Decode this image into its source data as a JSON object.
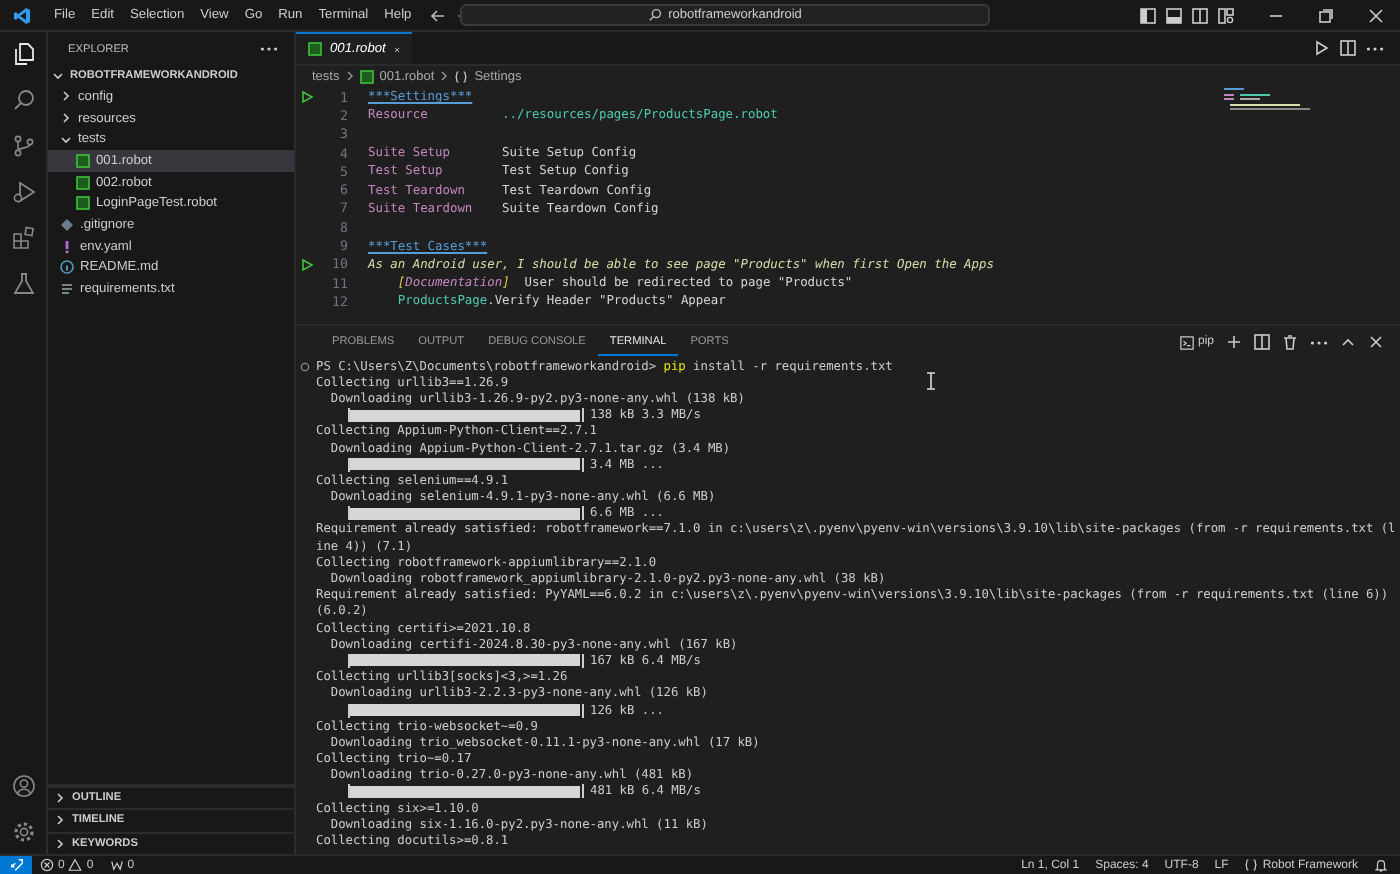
{
  "title_bar": {
    "menu": [
      "File",
      "Edit",
      "Selection",
      "View",
      "Go",
      "Run",
      "Terminal",
      "Help"
    ],
    "search": {
      "value": "robotframeworkandroid"
    }
  },
  "sidebar": {
    "title": "EXPLORER",
    "root": {
      "name": "ROBOTFRAMEWORKANDROID",
      "expanded": true,
      "children": [
        {
          "name": "config",
          "kind": "folder",
          "expanded": false,
          "selected": false
        },
        {
          "name": "resources",
          "kind": "folder",
          "expanded": false,
          "selected": false
        },
        {
          "name": "tests",
          "kind": "folder",
          "expanded": true,
          "selected": false,
          "children": [
            {
              "name": "001.robot",
              "kind": "robot",
              "selected": true
            },
            {
              "name": "002.robot",
              "kind": "robot",
              "selected": false
            },
            {
              "name": "LoginPageTest.robot",
              "kind": "robot",
              "selected": false
            }
          ]
        },
        {
          "name": ".gitignore",
          "kind": "gitignore",
          "selected": false
        },
        {
          "name": "env.yaml",
          "kind": "yaml",
          "selected": false
        },
        {
          "name": "README.md",
          "kind": "markdown",
          "selected": false
        },
        {
          "name": "requirements.txt",
          "kind": "text",
          "selected": false
        }
      ]
    },
    "sections": [
      {
        "label": "OUTLINE",
        "expanded": false
      },
      {
        "label": "TIMELINE",
        "expanded": false
      },
      {
        "label": "KEYWORDS",
        "expanded": false
      }
    ]
  },
  "editor": {
    "tab": {
      "label": "001.robot"
    },
    "breadcrumb": [
      "tests",
      "001.robot",
      "Settings"
    ],
    "lines": [
      {
        "number": "1",
        "kind": "section",
        "run": true,
        "segments": [
          {
            "kind": "header",
            "text": "***Settings***"
          }
        ]
      },
      {
        "number": "2",
        "kind": "setting",
        "run": false,
        "segments": [
          {
            "kind": "setting",
            "text": "Resource"
          },
          {
            "kind": "path",
            "text": "../resources/pages/ProductsPage.robot"
          }
        ]
      },
      {
        "number": "3",
        "kind": "blank",
        "run": false
      },
      {
        "number": "4",
        "kind": "setting",
        "run": false,
        "segments": [
          {
            "kind": "setting",
            "text": "Suite Setup"
          },
          {
            "kind": "plain",
            "text": "Suite Setup Config"
          }
        ]
      },
      {
        "number": "5",
        "kind": "setting",
        "run": false,
        "segments": [
          {
            "kind": "setting",
            "text": "Test Setup"
          },
          {
            "kind": "plain",
            "text": "Test Setup Config"
          }
        ]
      },
      {
        "number": "6",
        "kind": "setting",
        "run": false,
        "segments": [
          {
            "kind": "setting",
            "text": "Test Teardown"
          },
          {
            "kind": "plain",
            "text": "Test Teardown Config"
          }
        ]
      },
      {
        "number": "7",
        "kind": "setting",
        "run": false,
        "segments": [
          {
            "kind": "setting",
            "text": "Suite Teardown"
          },
          {
            "kind": "plain",
            "text": "Suite Teardown Config"
          }
        ]
      },
      {
        "number": "8",
        "kind": "blank",
        "run": false
      },
      {
        "number": "9",
        "kind": "section",
        "run": false,
        "segments": [
          {
            "kind": "header",
            "text": "***Test Cases***"
          }
        ]
      },
      {
        "number": "10",
        "kind": "test",
        "run": true,
        "segments": [
          {
            "kind": "testname",
            "text": "As an Android user, I should be able to see page \"Products\" when first Open the Apps"
          }
        ]
      },
      {
        "number": "11",
        "kind": "step",
        "run": false,
        "segments": [
          {
            "kind": "bracket",
            "text": "["
          },
          {
            "kind": "doc",
            "text": "Documentation"
          },
          {
            "kind": "bracket",
            "text": "]"
          },
          {
            "kind": "plain",
            "text": "  User should be redirected to page \"Products\""
          }
        ]
      },
      {
        "number": "12",
        "kind": "step",
        "run": false,
        "segments": [
          {
            "kind": "library",
            "text": "ProductsPage"
          },
          {
            "kind": "plain",
            "text": ".Verify Header \"Products\" Appear"
          }
        ]
      }
    ]
  },
  "panel": {
    "tabs": [
      {
        "label": "PROBLEMS",
        "selected": false
      },
      {
        "label": "OUTPUT",
        "selected": false
      },
      {
        "label": "DEBUG CONSOLE",
        "selected": false
      },
      {
        "label": "TERMINAL",
        "selected": true
      },
      {
        "label": "PORTS",
        "selected": false
      }
    ],
    "terminal_name": "pip",
    "terminal": [
      {
        "kind": "command",
        "prompt": "PS C:\\Users\\Z\\Documents\\robotframeworkandroid> ",
        "command": "pip",
        "args": " install -r requirements.txt"
      },
      {
        "kind": "text",
        "text": "Collecting urllib3==1.26.9"
      },
      {
        "kind": "text",
        "text": "  Downloading urllib3-1.26.9-py2.py3-none-any.whl (138 kB)"
      },
      {
        "kind": "progress",
        "level": 1,
        "text": "138 kB 3.3 MB/s"
      },
      {
        "kind": "text",
        "text": "Collecting Appium-Python-Client==2.7.1"
      },
      {
        "kind": "text",
        "text": "  Downloading Appium-Python-Client-2.7.1.tar.gz (3.4 MB)"
      },
      {
        "kind": "progress",
        "level": 1,
        "text": "3.4 MB ..."
      },
      {
        "kind": "text",
        "text": "Collecting selenium==4.9.1"
      },
      {
        "kind": "text",
        "text": "  Downloading selenium-4.9.1-py3-none-any.whl (6.6 MB)"
      },
      {
        "kind": "progress",
        "level": 1,
        "text": "6.6 MB ..."
      },
      {
        "kind": "text",
        "text": "Requirement already satisfied: robotframework==7.1.0 in c:\\users\\z\\.pyenv\\pyenv-win\\versions\\3.9.10\\lib\\site-packages (from -r requirements.txt (l"
      },
      {
        "kind": "text",
        "text": "ine 4)) (7.1)"
      },
      {
        "kind": "text",
        "text": "Collecting robotframework-appiumlibrary==2.1.0"
      },
      {
        "kind": "text",
        "text": "  Downloading robotframework_appiumlibrary-2.1.0-py2.py3-none-any.whl (38 kB)"
      },
      {
        "kind": "text",
        "text": "Requirement already satisfied: PyYAML==6.0.2 in c:\\users\\z\\.pyenv\\pyenv-win\\versions\\3.9.10\\lib\\site-packages (from -r requirements.txt (line 6))"
      },
      {
        "kind": "text",
        "text": "(6.0.2)"
      },
      {
        "kind": "text",
        "text": "Collecting certifi>=2021.10.8"
      },
      {
        "kind": "text",
        "text": "  Downloading certifi-2024.8.30-py3-none-any.whl (167 kB)"
      },
      {
        "kind": "progress",
        "level": 1,
        "text": "167 kB 6.4 MB/s"
      },
      {
        "kind": "text",
        "text": "Collecting urllib3[socks]<3,>=1.26"
      },
      {
        "kind": "text",
        "text": "  Downloading urllib3-2.2.3-py3-none-any.whl (126 kB)"
      },
      {
        "kind": "progress",
        "level": 1,
        "text": "126 kB ..."
      },
      {
        "kind": "text",
        "text": "Collecting trio-websocket~=0.9"
      },
      {
        "kind": "text",
        "text": "  Downloading trio_websocket-0.11.1-py3-none-any.whl (17 kB)"
      },
      {
        "kind": "text",
        "text": "Collecting trio~=0.17"
      },
      {
        "kind": "text",
        "text": "  Downloading trio-0.27.0-py3-none-any.whl (481 kB)"
      },
      {
        "kind": "progress",
        "level": 1,
        "text": "481 kB 6.4 MB/s"
      },
      {
        "kind": "text",
        "text": "Collecting six>=1.10.0"
      },
      {
        "kind": "text",
        "text": "  Downloading six-1.16.0-py2.py3-none-any.whl (11 kB)"
      },
      {
        "kind": "text",
        "text": "Collecting docutils>=0.8.1"
      }
    ]
  },
  "status_bar": {
    "errors": "0",
    "warnings": "0",
    "ports": "0",
    "position": "Ln 1, Col 1",
    "indent": "Spaces: 4",
    "encoding": "UTF-8",
    "eol": "LF",
    "language": "Robot Framework"
  }
}
